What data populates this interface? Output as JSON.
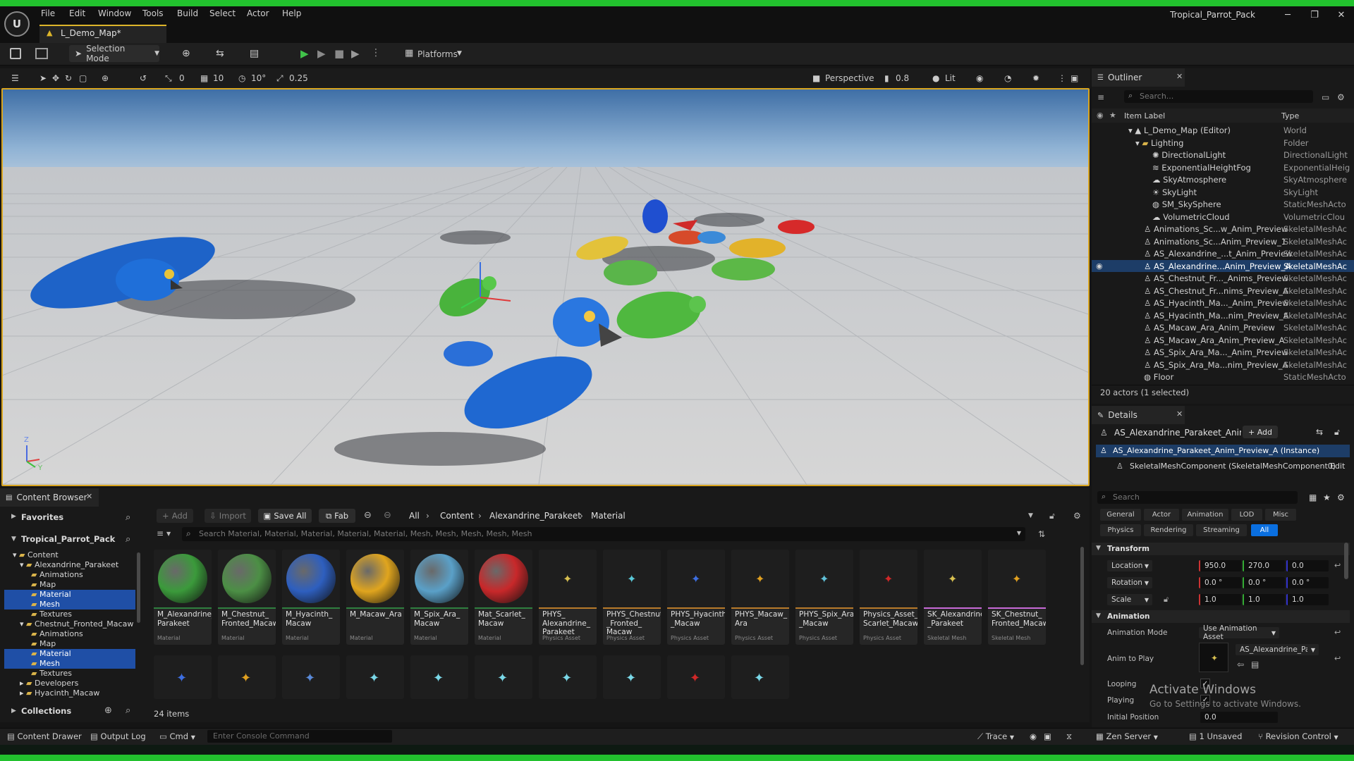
{
  "window": {
    "title": "Tropical_Parrot_Pack",
    "app_logo": "U",
    "menu": [
      "File",
      "Edit",
      "Window",
      "Tools",
      "Build",
      "Select",
      "Actor",
      "Help"
    ],
    "doc_tab": "L_Demo_Map*",
    "accent_color": "#22c22e"
  },
  "toolbar": {
    "selection_mode": "Selection Mode",
    "platforms": "Platforms"
  },
  "viewport_toolbar": {
    "rotation_snap": "0",
    "grid_snap": "10",
    "angle_snap": "10°",
    "scale_snap": "0.25",
    "perspective": "Perspective",
    "camera_speed": "0.8",
    "lit": "Lit"
  },
  "outliner": {
    "tab_title": "Outliner",
    "search_placeholder": "Search...",
    "col_label": "Item Label",
    "col_type": "Type",
    "rows": [
      {
        "label": "L_Demo_Map (Editor)",
        "type": "World"
      },
      {
        "label": "Lighting",
        "type": "Folder"
      },
      {
        "label": "DirectionalLight",
        "type": "DirectionalLight"
      },
      {
        "label": "ExponentialHeightFog",
        "type": "ExponentialHeig"
      },
      {
        "label": "SkyAtmosphere",
        "type": "SkyAtmosphere"
      },
      {
        "label": "SkyLight",
        "type": "SkyLight"
      },
      {
        "label": "SM_SkySphere",
        "type": "StaticMeshActo"
      },
      {
        "label": "VolumetricCloud",
        "type": "VolumetricClou"
      },
      {
        "label": "Animations_Sc...w_Anim_Preview",
        "type": "SkeletalMeshAc"
      },
      {
        "label": "Animations_Sc...Anim_Preview_1",
        "type": "SkeletalMeshAc"
      },
      {
        "label": "AS_Alexandrine_...t_Anim_Preview",
        "type": "SkeletalMeshAc"
      },
      {
        "label": "AS_Alexandrine...Anim_Preview_A",
        "type": "SkeletalMeshAc"
      },
      {
        "label": "AS_Chestnut_Fr..._Anims_Preview",
        "type": "SkeletalMeshAc"
      },
      {
        "label": "AS_Chestnut_Fr...nims_Preview_A",
        "type": "SkeletalMeshAc"
      },
      {
        "label": "AS_Hyacinth_Ma..._Anim_Preview",
        "type": "SkeletalMeshAc"
      },
      {
        "label": "AS_Hyacinth_Ma...nim_Preview_A",
        "type": "SkeletalMeshAc"
      },
      {
        "label": "AS_Macaw_Ara_Anim_Preview",
        "type": "SkeletalMeshAc"
      },
      {
        "label": "AS_Macaw_Ara_Anim_Preview_A",
        "type": "SkeletalMeshAc"
      },
      {
        "label": "AS_Spix_Ara_Ma..._Anim_Preview",
        "type": "SkeletalMeshAc"
      },
      {
        "label": "AS_Spix_Ara_Ma...nim_Preview_A",
        "type": "SkeletalMeshAc"
      },
      {
        "label": "Floor",
        "type": "StaticMeshActo"
      }
    ],
    "footer": "20 actors (1 selected)"
  },
  "details": {
    "tab_title": "Details",
    "actor_name": "AS_Alexandrine_Parakeet_Anim_Pre",
    "add_label": "+ Add",
    "instance_row": "AS_Alexandrine_Parakeet_Anim_Preview_A (Instance)",
    "component_row": "SkeletalMeshComponent (SkeletalMeshComponent0)",
    "edit_label": "Edit",
    "search_placeholder": "Search",
    "filters_row1": [
      "General",
      "Actor",
      "Animation",
      "LOD",
      "Misc"
    ],
    "filters_row2": [
      "Physics",
      "Rendering",
      "Streaming",
      "All"
    ],
    "transform_header": "Transform",
    "location_label": "Location",
    "location": [
      "950.0",
      "270.0",
      "0.0"
    ],
    "rotation_label": "Rotation",
    "rotation": [
      "0.0 °",
      "0.0 °",
      "0.0 °"
    ],
    "scale_label": "Scale",
    "scale": [
      "1.0",
      "1.0",
      "1.0"
    ],
    "animation_header": "Animation",
    "animation_mode_label": "Animation Mode",
    "animation_mode": "Use Animation Asset",
    "anim_to_play_label": "Anim to Play",
    "anim_to_play": "AS_Alexandrine_Parak",
    "looping_label": "Looping",
    "playing_label": "Playing",
    "initial_position_label": "Initial Position",
    "initial_position": "0.0"
  },
  "content_browser": {
    "tab_title": "Content Browser",
    "favorites": "Favorites",
    "project": "Tropical_Parrot_Pack",
    "collections": "Collections",
    "add": "Add",
    "import": "Import",
    "save_all": "Save All",
    "fab": "Fab",
    "breadcrumb": [
      "All",
      "Content",
      "Alexandrine_Parakeet",
      "Material"
    ],
    "search_placeholder": "Search Material, Material, Material, Material, Material, Mesh, Mesh, Mesh, Mesh, Mesh",
    "item_count": "24 items",
    "tree": [
      {
        "label": "Content",
        "depth": 0,
        "selected": false
      },
      {
        "label": "Alexandrine_Parakeet",
        "depth": 1,
        "selected": false
      },
      {
        "label": "Animations",
        "depth": 2,
        "selected": false
      },
      {
        "label": "Map",
        "depth": 2,
        "selected": false
      },
      {
        "label": "Material",
        "depth": 2,
        "selected": true
      },
      {
        "label": "Mesh",
        "depth": 2,
        "selected": true
      },
      {
        "label": "Textures",
        "depth": 2,
        "selected": false
      },
      {
        "label": "Chestnut_Fronted_Macaw",
        "depth": 1,
        "selected": false
      },
      {
        "label": "Animations",
        "depth": 2,
        "selected": false
      },
      {
        "label": "Map",
        "depth": 2,
        "selected": false
      },
      {
        "label": "Material",
        "depth": 2,
        "selected": true
      },
      {
        "label": "Mesh",
        "depth": 2,
        "selected": true
      },
      {
        "label": "Textures",
        "depth": 2,
        "selected": false
      },
      {
        "label": "Developers",
        "depth": 1,
        "selected": false
      },
      {
        "label": "Hyacinth_Macaw",
        "depth": 1,
        "selected": false
      }
    ],
    "assets": [
      {
        "name": "M_Alexandrine_\nParakeet",
        "kind": "Material",
        "color": "#3b9a3b"
      },
      {
        "name": "M_Chestnut_\nFronted_Macaw",
        "kind": "Material",
        "color": "#4c8f45"
      },
      {
        "name": "M_Hyacinth_\nMacaw",
        "kind": "Material",
        "color": "#2e5fbf"
      },
      {
        "name": "M_Macaw_Ara",
        "kind": "Material",
        "color": "#e0a51e"
      },
      {
        "name": "M_Spix_Ara_\nMacaw",
        "kind": "Material",
        "color": "#5aa0c8"
      },
      {
        "name": "Mat_Scarlet_\nMacaw",
        "kind": "Material",
        "color": "#c8282a"
      },
      {
        "name": "PHYS_\nAlexandrine_\nParakeet",
        "kind": "Physics Asset",
        "color": "#d8c050"
      },
      {
        "name": "PHYS_Chestnut\n_Fronted_\nMacaw",
        "kind": "Physics Asset",
        "color": "#5ac8d8"
      },
      {
        "name": "PHYS_Hyacinth\n_Macaw",
        "kind": "Physics Asset",
        "color": "#3d6ee0"
      },
      {
        "name": "PHYS_Macaw_\nAra",
        "kind": "Physics Asset",
        "color": "#e0a020"
      },
      {
        "name": "PHYS_Spix_Ara\n_Macaw",
        "kind": "Physics Asset",
        "color": "#60c0d8"
      },
      {
        "name": "Physics_Asset_\nScarlet_Macaw",
        "kind": "Physics Asset",
        "color": "#d02828"
      },
      {
        "name": "SK_Alexandrine\n_Parakeet",
        "kind": "Skeletal Mesh",
        "color": "#d8c050"
      },
      {
        "name": "SK_Chestnut_\nFronted_Macaw",
        "kind": "Skeletal Mesh",
        "color": "#e0a020"
      }
    ],
    "assets_row2_colors": [
      "#3d6ee0",
      "#e0a020",
      "#5a8ad8",
      "#7ad8e8",
      "#7ad8e8",
      "#7ad8e8",
      "#7ad8e8",
      "#7ad8e8",
      "#d02828",
      "#7ad8e8"
    ]
  },
  "statusbar": {
    "content_drawer": "Content Drawer",
    "output_log": "Output Log",
    "cmd": "Cmd",
    "console_placeholder": "Enter Console Command",
    "trace": "Trace",
    "zen_server": "Zen Server",
    "unsaved": "1 Unsaved",
    "revision_control": "Revision Control"
  },
  "watermark": {
    "line1": "Activate Windows",
    "line2": "Go to Settings to activate Windows."
  }
}
